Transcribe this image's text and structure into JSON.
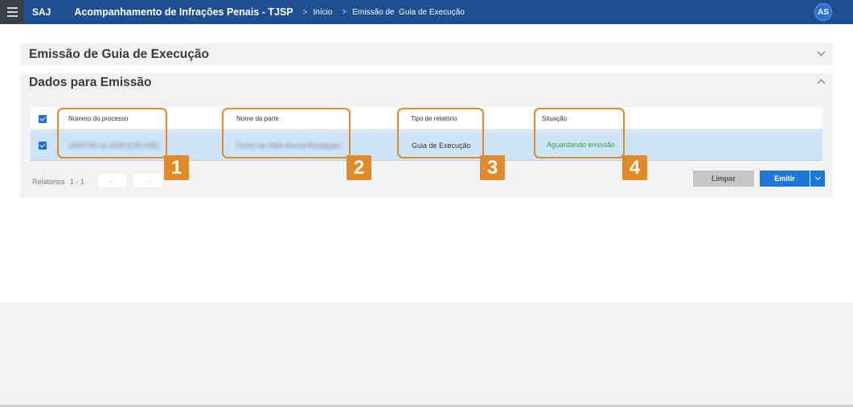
{
  "header": {
    "app_name": "SAJ",
    "title": "Acompanhamento de Infrações Penais - TJSP",
    "breadcrumb": [
      "Início",
      "Emissão de  Guia de Execução"
    ],
    "user_initials": "AS",
    "breadcrumb_sep": ">"
  },
  "panels": {
    "emissao_title": "Emissão de Guia de Execução",
    "dados_title": "Dados para Emissão"
  },
  "table": {
    "columns": [
      "Número do processo",
      "Nome da parte",
      "Tipo de relatório",
      "Situação"
    ],
    "rows": [
      {
        "numero": "0000790-11.2020.8.26.0152",
        "nome": "Pedro da Silva Souza Rodrigues",
        "tipo": "Guia de Execução",
        "situacao": "Aguardando emissão",
        "selected": true
      }
    ]
  },
  "callouts": [
    "1",
    "2",
    "3",
    "4"
  ],
  "pager": {
    "label": "Relatórios",
    "range": "1 - 1",
    "prev": "←",
    "next": "→"
  },
  "actions": {
    "clear": "Limpar",
    "emit": "Emitir"
  },
  "colors": {
    "topbar": "#1d4f91",
    "accent": "#e08a2a",
    "selected_row": "#cfe4f7",
    "status_green": "#2aa84a",
    "primary_button": "#1e78d6"
  }
}
